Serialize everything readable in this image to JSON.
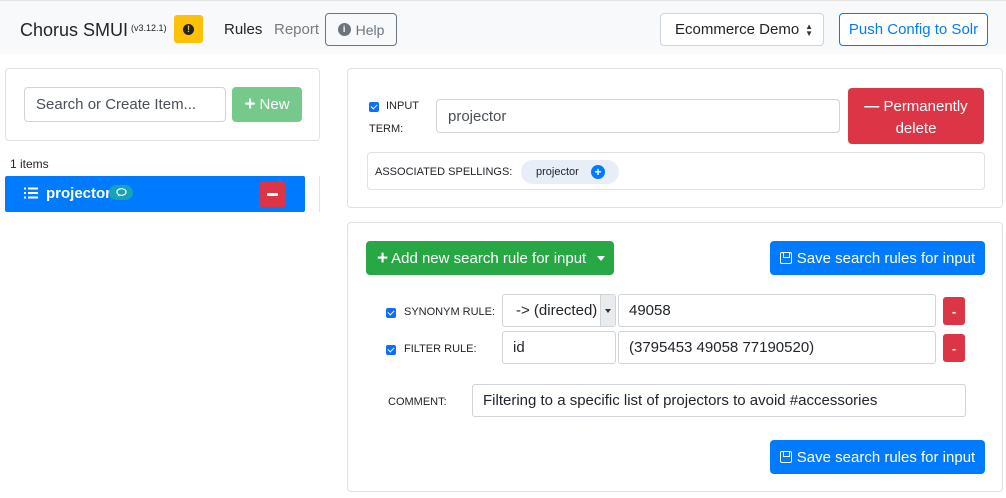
{
  "navbar": {
    "brand": "Chorus SMUI",
    "version": "(v3.12.1)",
    "warning_icon": "exclamation-circle-icon",
    "links": {
      "rules": "Rules",
      "report": "Report"
    },
    "help_label": "Help",
    "solr_index_selected": "Ecommerce Demo",
    "push_config_label": "Push Config to Solr"
  },
  "sidebar": {
    "search_placeholder": "Search or Create Item...",
    "new_label": "New",
    "items_count": "1 items",
    "items": [
      {
        "label": "projector",
        "icon": "list-icon",
        "badge_icon": "comment-icon"
      }
    ]
  },
  "input_details": {
    "enabled": true,
    "input_term_label_1": "INPUT",
    "input_term_label_2": "TERM:",
    "input_term_value": "projector",
    "permanently_delete_line1": "Permanently",
    "permanently_delete_line2": "delete",
    "associated_spellings_label": "ASSOCIATED SPELLINGS:",
    "spellings": [
      "projector"
    ]
  },
  "rules": {
    "add_rule_label": "Add new search rule for input",
    "save_label": "Save search rules for input",
    "synonym": {
      "enabled": true,
      "label": "SYNONYM RULE:",
      "direction": "-> (directed)",
      "term": "49058",
      "delete_label": "-"
    },
    "filter": {
      "enabled": true,
      "label": "FILTER RULE:",
      "field": "id",
      "value": "(3795453 49058 77190520)",
      "delete_label": "-"
    },
    "comment_label": "COMMENT:",
    "comment_value": "Filtering to a specific list of projectors to avoid #accessories"
  },
  "colors": {
    "primary": "#007bff",
    "success": "#28a745",
    "danger": "#dc3545",
    "warning": "#ffc107",
    "info": "#17a2b8"
  }
}
